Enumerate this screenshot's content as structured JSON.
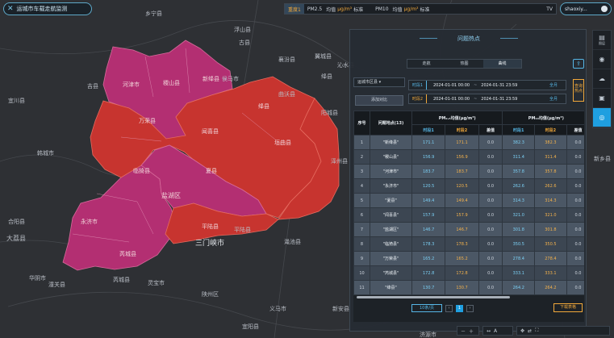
{
  "app": {
    "title": "运城市车载走航监测",
    "logo_icon": "x-logo-icon"
  },
  "topbar": {
    "active": "重度1",
    "pm25_label": "PM2.5",
    "pm25_unit_prefix": "均值",
    "pm25_unit": "μg/m³",
    "pm25_extra": "标准",
    "pm10_label": "PM10",
    "pm10_unit_prefix": "均值",
    "pm10_unit": "μg/m³",
    "pm10_extra": "标准",
    "tvoc": "TV"
  },
  "user": {
    "name": "shaoxiy..."
  },
  "sidebar": [
    {
      "icon": "layers-icon",
      "label": "图层"
    },
    {
      "icon": "location-icon",
      "label": ""
    },
    {
      "icon": "cloud-icon",
      "label": ""
    },
    {
      "icon": "image-icon",
      "label": ""
    },
    {
      "icon": "target-icon",
      "label": ""
    }
  ],
  "panel": {
    "title": "问题热点",
    "tabs": [
      "走航",
      "热图",
      "曲线"
    ],
    "selected_tab": "曲线",
    "region_select": "运城市区县",
    "add_button": "添加对比",
    "time_rows": [
      {
        "label": "时段1",
        "start": "2024-01-01 00:00",
        "end": "2024-01-31 23:59",
        "agg": "全月"
      },
      {
        "label": "时段2",
        "start": "2024-01-01 00:00",
        "end": "2024-01-31 23:59",
        "agg": "全月"
      }
    ],
    "query_button": "查询热点",
    "table": {
      "headers": {
        "index": "序号",
        "name": "问题地点(13)",
        "pm25": "PM₂.₅均值(μg/m³)",
        "pm10": "PM₁₀均值(μg/m³)",
        "tvoc": "T"
      },
      "subheaders": [
        "时段1",
        "时段2",
        "差值",
        "时段1",
        "时段2",
        "差值"
      ],
      "rows": [
        {
          "idx": "1",
          "name": "\"新绛县\"",
          "a1": "171.1",
          "a2": "171.1",
          "ad": "0.0",
          "b1": "382.3",
          "b2": "382.3",
          "bd": "0.0",
          "t": "N/A"
        },
        {
          "idx": "2",
          "name": "\"稷山县\"",
          "a1": "156.9",
          "a2": "156.9",
          "ad": "0.0",
          "b1": "311.4",
          "b2": "311.4",
          "bd": "0.0",
          "t": "0.227"
        },
        {
          "idx": "3",
          "name": "\"河津市\"",
          "a1": "183.7",
          "a2": "183.7",
          "ad": "0.0",
          "b1": "357.8",
          "b2": "357.8",
          "bd": "0.0",
          "t": "N/A"
        },
        {
          "idx": "4",
          "name": "\"永济市\"",
          "a1": "120.5",
          "a2": "120.5",
          "ad": "0.0",
          "b1": "262.6",
          "b2": "262.6",
          "bd": "0.0",
          "t": "N/A"
        },
        {
          "idx": "5",
          "name": "\"夏县\"",
          "a1": "149.4",
          "a2": "149.4",
          "ad": "0.0",
          "b1": "314.3",
          "b2": "314.3",
          "bd": "0.0",
          "t": "N/A"
        },
        {
          "idx": "6",
          "name": "\"闻喜县\"",
          "a1": "157.9",
          "a2": "157.9",
          "ad": "0.0",
          "b1": "321.0",
          "b2": "321.0",
          "bd": "0.0",
          "t": "N/A"
        },
        {
          "idx": "7",
          "name": "\"盐湖区\"",
          "a1": "146.7",
          "a2": "146.7",
          "ad": "0.0",
          "b1": "301.8",
          "b2": "301.8",
          "bd": "0.0",
          "t": "0.229"
        },
        {
          "idx": "8",
          "name": "\"临猗县\"",
          "a1": "178.3",
          "a2": "178.3",
          "ad": "0.0",
          "b1": "350.5",
          "b2": "350.5",
          "bd": "0.0",
          "t": "N/A"
        },
        {
          "idx": "9",
          "name": "\"万荣县\"",
          "a1": "165.2",
          "a2": "165.2",
          "ad": "0.0",
          "b1": "278.4",
          "b2": "278.4",
          "bd": "0.0",
          "t": "N/A"
        },
        {
          "idx": "10",
          "name": "\"芮城县\"",
          "a1": "172.8",
          "a2": "172.8",
          "ad": "0.0",
          "b1": "333.1",
          "b2": "333.1",
          "bd": "0.0",
          "t": "N/A"
        },
        {
          "idx": "11",
          "name": "\"绛县\"",
          "a1": "130.7",
          "a2": "130.7",
          "ad": "0.0",
          "b1": "264.2",
          "b2": "264.2",
          "bd": "0.0",
          "t": "N/A"
        }
      ]
    },
    "pager": {
      "page_size": "10条/页",
      "current": "1"
    },
    "download_button": "下载表格"
  },
  "map": {
    "labels": [
      "乡宁县",
      "浮山县",
      "古县",
      "襄汾县",
      "翼城县",
      "侯马市",
      "曲沃县",
      "绛县",
      "沁水县",
      "阳城县",
      "泽州县",
      "芮城县",
      "平陆县",
      "三门峡市",
      "渑池县",
      "灵宝市",
      "潼关县",
      "华阴市",
      "大荔县",
      "合阳县",
      "韩城市",
      "宜川县",
      "吉县",
      "陕州区",
      "义马市",
      "济源市",
      "新安县",
      "宜阳县",
      "新乡县"
    ],
    "regions": [
      "河津市",
      "稷山县",
      "新绛县",
      "万荣县",
      "闻喜县",
      "绛县",
      "临猗县",
      "盐湖区",
      "夏县",
      "垣曲县",
      "永济市",
      "平陆县",
      "芮城县"
    ]
  }
}
